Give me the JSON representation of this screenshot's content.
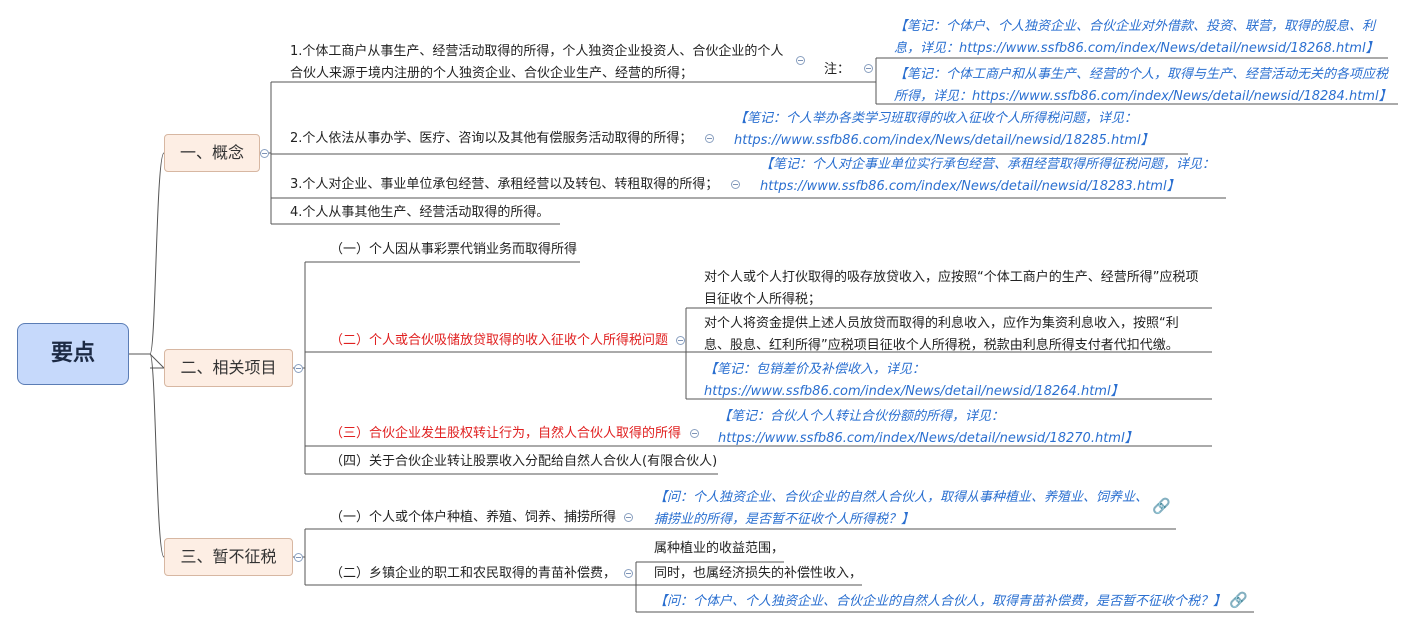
{
  "root": "要点",
  "branches": [
    {
      "label": "一、概念",
      "items": [
        "1.个体工商户从事生产、经营活动取得的所得，个人独资企业投资人、合伙企业的个人合伙人来源于境内注册的个人独资企业、合伙企业生产、经营的所得；",
        "2.个人依法从事办学、医疗、咨询以及其他有偿服务活动取得的所得；",
        "3.个人对企业、事业单位承包经营、承租经营以及转包、转租取得的所得；",
        "4.个人从事其他生产、经营活动取得的所得。"
      ],
      "note_label": "注：",
      "notes": [
        "【笔记：个体户、个人独资企业、合伙企业对外借款、投资、联营，取得的股息、利息，详见：https://www.ssfb86.com/index/News/detail/newsid/18268.html】",
        "【笔记：个体工商户和从事生产、经营的个人，取得与生产、经营活动无关的各项应税所得，详见：https://www.ssfb86.com/index/News/detail/newsid/18284.html】",
        "【笔记：个人举办各类学习班取得的收入征收个人所得税问题，详见：https://www.ssfb86.com/index/News/detail/newsid/18285.html】",
        "【笔记：个人对企事业单位实行承包经营、承租经营取得所得征税问题，详见：https://www.ssfb86.com/index/News/detail/newsid/18283.html】"
      ]
    },
    {
      "label": "二、相关项目",
      "items": [
        "（一）个人因从事彩票代销业务而取得所得",
        "（二）个人或合伙吸储放贷取得的收入征收个人所得税问题",
        "（三）合伙企业发生股权转让行为，自然人合伙人取得的所得",
        "（四）关于合伙企业转让股票收入分配给自然人合伙人(有限合伙人)"
      ],
      "subitems": [
        "对个人或个人打伙取得的吸存放贷收入，应按照“个体工商户的生产、经营所得”应税项目征收个人所得税；",
        "对个人将资金提供上述人员放贷而取得的利息收入，应作为集资利息收入，按照“利息、股息、红利所得”应税项目征收个人所得税，税款由利息所得支付者代扣代缴。"
      ],
      "notes": [
        "【笔记：包销差价及补偿收入，详见：https://www.ssfb86.com/index/News/detail/newsid/18264.html】",
        "【笔记：合伙人个人转让合伙份额的所得，详见：https://www.ssfb86.com/index/News/detail/newsid/18270.html】"
      ]
    },
    {
      "label": "三、暂不征税",
      "items": [
        "（一）个人或个体户种植、养殖、饲养、捕捞所得",
        "（二）乡镇企业的职工和农民取得的青苗补偿费，"
      ],
      "subitems": [
        "属种植业的收益范围，",
        "同时，也属经济损失的补偿性收入，"
      ],
      "notes": [
        "【问：个人独资企业、合伙企业的自然人合伙人，取得从事种植业、养殖业、饲养业、捕捞业的所得，是否暂不征收个人所得税？】",
        "【问：个体户、个人独资企业、合伙企业的自然人合伙人，取得青苗补偿费，是否暂不征收个税？】"
      ]
    }
  ],
  "colors": {
    "root_fill": "#c6d9fb",
    "topic_fill": "#fdeee4",
    "note": "#2a6fd0",
    "highlight": "#e02020"
  },
  "icons": {
    "collapse": "minus-circle-icon",
    "link": "link-icon"
  }
}
